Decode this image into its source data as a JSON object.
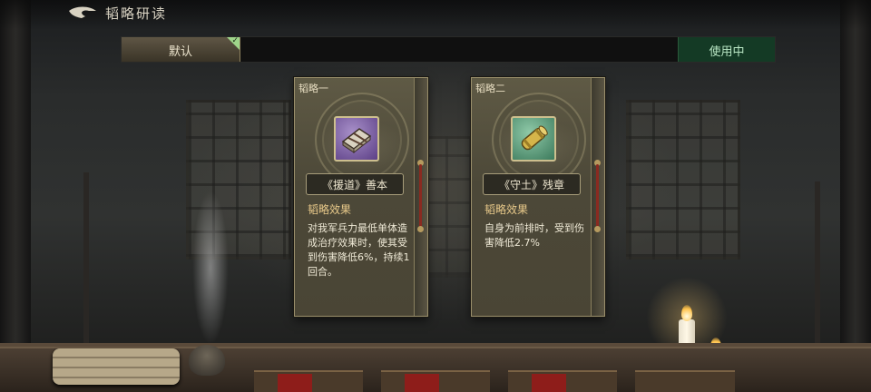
{
  "header": {
    "title": "韬略研读"
  },
  "tabs": {
    "default_label": "默认",
    "in_use_label": "使用中"
  },
  "cards": [
    {
      "tag": "韬略一",
      "name": "《援道》善本",
      "effect_label": "韬略效果",
      "effect_desc": "对我军兵力最低单体造成治疗效果时，使其受到伤害降低6%，持续1回合。",
      "icon": "book-bundle-icon"
    },
    {
      "tag": "韬略二",
      "name": "《守土》残章",
      "effect_label": "韬略效果",
      "effect_desc": "自身为前排时，受到伤害降低2.7%",
      "icon": "scroll-icon"
    }
  ],
  "colors": {
    "accent_gold": "#e8c98a",
    "in_use_green": "#143a25",
    "check_green": "#9fd48a",
    "seal_red": "#8e1d1a"
  }
}
